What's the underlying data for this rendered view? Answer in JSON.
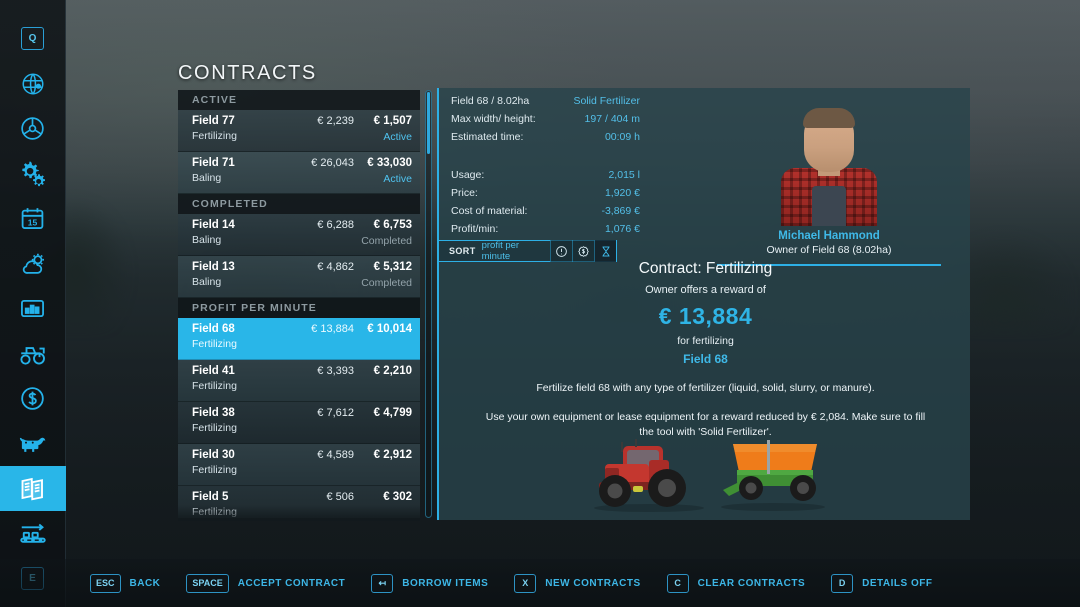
{
  "window": {
    "title": "CONTRACTS"
  },
  "sidebar": {
    "items": [
      {
        "name": "help-key-q",
        "icon": "key-q-icon",
        "label": "Q",
        "active": false
      },
      {
        "name": "map-globe",
        "icon": "globe-icon",
        "label": "",
        "active": false
      },
      {
        "name": "vehicle-steering",
        "icon": "steering-wheel-icon",
        "label": "",
        "active": false
      },
      {
        "name": "settings-gears",
        "icon": "gears-icon",
        "label": "",
        "active": false
      },
      {
        "name": "calendar",
        "icon": "calendar-icon",
        "label": "15",
        "active": false
      },
      {
        "name": "weather",
        "icon": "weather-sun-cloud-icon",
        "label": "",
        "active": false
      },
      {
        "name": "statistics",
        "icon": "bar-chart-icon",
        "label": "",
        "active": false
      },
      {
        "name": "vehicles",
        "icon": "tractor-icon",
        "label": "",
        "active": false
      },
      {
        "name": "finances",
        "icon": "dollar-circle-icon",
        "label": "",
        "active": false
      },
      {
        "name": "animals",
        "icon": "cow-icon",
        "label": "",
        "active": false
      },
      {
        "name": "contracts",
        "icon": "contracts-book-icon",
        "label": "",
        "active": true
      },
      {
        "name": "production",
        "icon": "conveyor-icon",
        "label": "",
        "active": false
      },
      {
        "name": "help-key-e",
        "icon": "key-e-icon",
        "label": "E",
        "active": false
      }
    ]
  },
  "contract_list": {
    "groups": [
      {
        "header": "ACTIVE",
        "rows": [
          {
            "field": "Field 77",
            "type": "Fertilizing",
            "value1": "€ 2,239",
            "value2": "€ 1,507",
            "status": "Active",
            "status_kind": "active",
            "selected": false
          },
          {
            "field": "Field 71",
            "type": "Baling",
            "value1": "€ 26,043",
            "value2": "€ 33,030",
            "status": "Active",
            "status_kind": "active",
            "selected": false
          }
        ]
      },
      {
        "header": "COMPLETED",
        "rows": [
          {
            "field": "Field 14",
            "type": "Baling",
            "value1": "€ 6,288",
            "value2": "€ 6,753",
            "status": "Completed",
            "status_kind": "completed",
            "selected": false
          },
          {
            "field": "Field 13",
            "type": "Baling",
            "value1": "€ 4,862",
            "value2": "€ 5,312",
            "status": "Completed",
            "status_kind": "completed",
            "selected": false
          }
        ]
      },
      {
        "header": "PROFIT PER MINUTE",
        "rows": [
          {
            "field": "Field 68",
            "type": "Fertilizing",
            "value1": "€ 13,884",
            "value2": "€ 10,014",
            "status": "",
            "status_kind": "",
            "selected": true
          },
          {
            "field": "Field 41",
            "type": "Fertilizing",
            "value1": "€ 3,393",
            "value2": "€ 2,210",
            "status": "",
            "status_kind": "",
            "selected": false
          },
          {
            "field": "Field 38",
            "type": "Fertilizing",
            "value1": "€ 7,612",
            "value2": "€ 4,799",
            "status": "",
            "status_kind": "",
            "selected": false
          },
          {
            "field": "Field 30",
            "type": "Fertilizing",
            "value1": "€ 4,589",
            "value2": "€ 2,912",
            "status": "",
            "status_kind": "",
            "selected": false
          },
          {
            "field": "Field 5",
            "type": "Fertilizing",
            "value1": "€ 506",
            "value2": "€ 302",
            "status": "",
            "status_kind": "",
            "selected": false
          }
        ]
      }
    ]
  },
  "detail": {
    "stats_top": [
      {
        "key": "Field 68 / 8.02ha",
        "value": "Solid Fertilizer"
      },
      {
        "key": "Max width/ height:",
        "value": "197 / 404 m"
      },
      {
        "key": "Estimated time:",
        "value": "00:09 h"
      }
    ],
    "stats_bottom": [
      {
        "key": "Usage:",
        "value": "2,015 l"
      },
      {
        "key": "Price:",
        "value": "1,920 €"
      },
      {
        "key": "Cost of material:",
        "value": "-3,869 €"
      },
      {
        "key": "Profit/min:",
        "value": "1,076 €"
      }
    ],
    "sort": {
      "label": "SORT",
      "mode": "profit per minute",
      "buttons": [
        {
          "name": "sort-by-priority",
          "icon": "exclamation-circle-icon",
          "active": false
        },
        {
          "name": "sort-by-money",
          "icon": "dollar-badge-icon",
          "active": false
        },
        {
          "name": "sort-by-time",
          "icon": "hourglass-icon",
          "active": true
        }
      ]
    },
    "owner": {
      "name": "Michael Hammond",
      "subtitle": "Owner of Field 68 (8.02ha)"
    },
    "contract": {
      "title": "Contract: Fertilizing",
      "reward_intro": "Owner offers a reward of",
      "reward": "€ 13,884",
      "reward_for": "for fertilizing",
      "field": "Field 68",
      "description_1": "Fertilize field 68 with any type of fertilizer (liquid, solid, slurry, or manure).",
      "description_2": "Use your own equipment or lease equipment for a reward reduced by € 2,084. Make sure to fill the tool with 'Solid Fertilizer'."
    },
    "vehicles": [
      {
        "name": "tractor-preview",
        "label": "tractor"
      },
      {
        "name": "spreader-preview",
        "label": "fertilizer spreader"
      }
    ]
  },
  "help_bar": {
    "items": [
      {
        "key": "ESC",
        "label": "BACK"
      },
      {
        "key": "SPACE",
        "label": "ACCEPT CONTRACT"
      },
      {
        "key": "↤",
        "label": "BORROW ITEMS"
      },
      {
        "key": "X",
        "label": "NEW CONTRACTS"
      },
      {
        "key": "C",
        "label": "CLEAR CONTRACTS"
      },
      {
        "key": "D",
        "label": "DETAILS OFF"
      }
    ]
  },
  "colors": {
    "accent": "#29b6e8",
    "accent_text": "#3fb9e8",
    "panel": "#28434b",
    "status_active": "#4fc3ef",
    "status_completed": "#93a3aa"
  }
}
